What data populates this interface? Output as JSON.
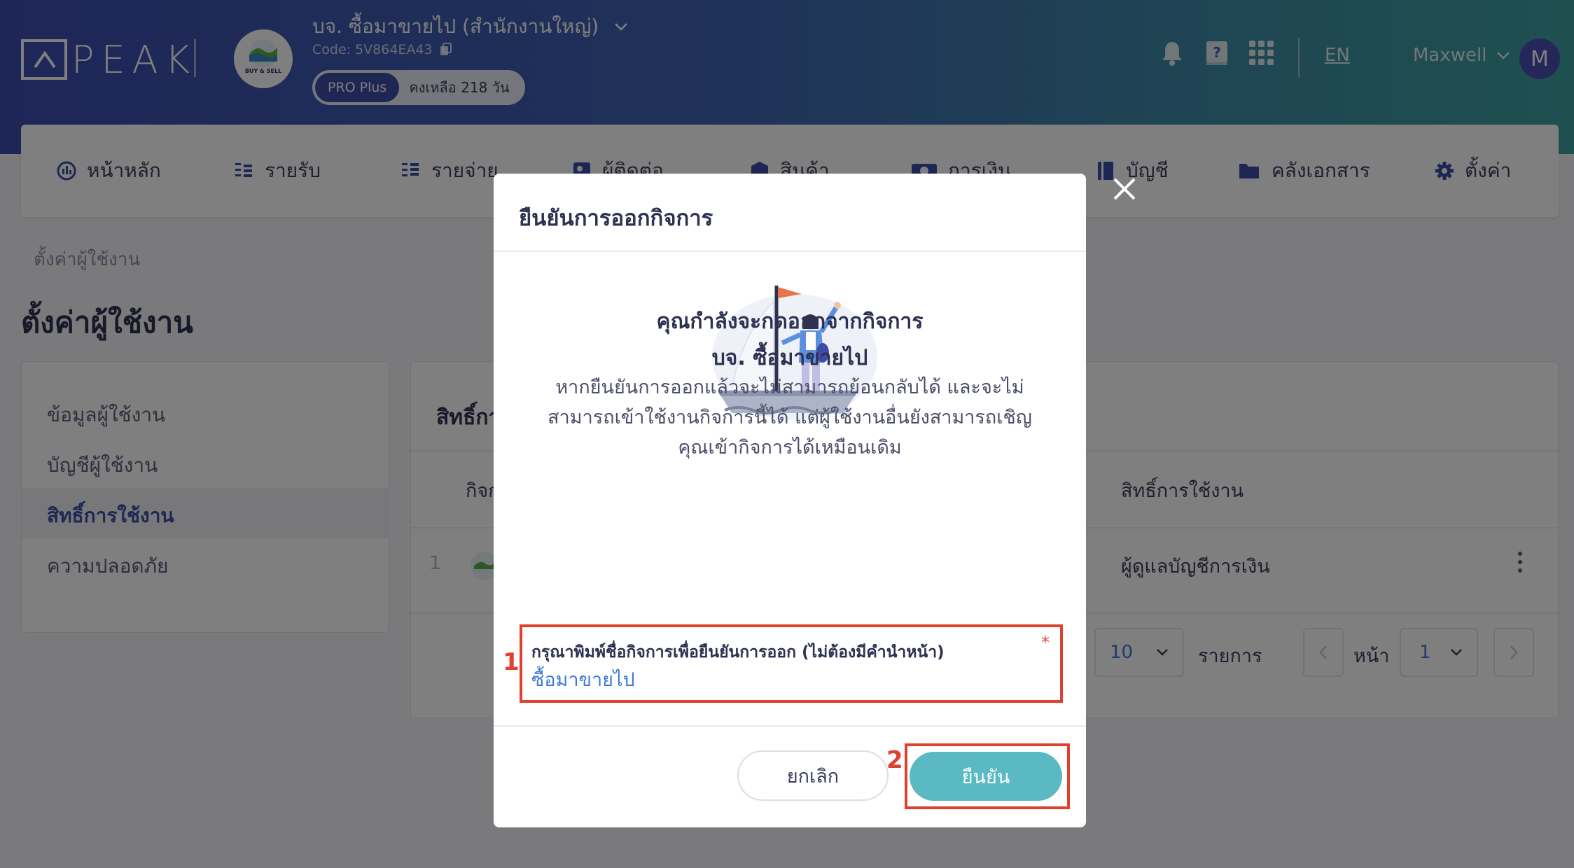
{
  "header": {
    "logo_text": "PEAK",
    "company_name": "บจ. ซื้อมาขายไป (สำนักงานใหญ่)",
    "company_code": "Code: 5V864EA43",
    "company_avatar_text": "BUY & SELL",
    "plan_badge": "PRO Plus",
    "plan_days": "คงเหลือ 218 วัน",
    "language": "EN",
    "user_name": "Maxwell",
    "user_initial": "M"
  },
  "nav": {
    "items": [
      {
        "label": "หน้าหลัก",
        "icon": "dashboard-icon"
      },
      {
        "label": "รายรับ",
        "icon": "income-icon"
      },
      {
        "label": "รายจ่าย",
        "icon": "expense-icon"
      },
      {
        "label": "ผู้ติดต่อ",
        "icon": "contacts-icon"
      },
      {
        "label": "สินค้า",
        "icon": "product-box-icon"
      },
      {
        "label": "การเงิน",
        "icon": "money-icon"
      },
      {
        "label": "บัญชี",
        "icon": "accounting-book-icon"
      },
      {
        "label": "คลังเอกสาร",
        "icon": "folder-icon"
      },
      {
        "label": "ตั้งค่า",
        "icon": "gear-icon"
      }
    ]
  },
  "page": {
    "breadcrumb": "ตั้งค่าผู้ใช้งาน",
    "title": "ตั้งค่าผู้ใช้งาน"
  },
  "sidebar": {
    "items": [
      {
        "label": "ข้อมูลผู้ใช้งาน"
      },
      {
        "label": "บัญชีผู้ใช้งาน"
      },
      {
        "label": "สิทธิ์การใช้งาน"
      },
      {
        "label": "ความปลอดภัย"
      }
    ]
  },
  "card": {
    "title": "สิทธิ์กา",
    "col_business": "กิจก",
    "col_permission": "สิทธิ์การใช้งาน",
    "row_index": "1",
    "row_permission": "ผู้ดูแลบัญชีการเงิน",
    "page_size": "10",
    "items_label": "รายการ",
    "page_label": "หน้า",
    "page_number": "1"
  },
  "modal": {
    "title": "ยืนยันการออกกิจการ",
    "heading_line1": "คุณกำลังจะกดออกจากกิจการ",
    "heading_line2": "บจ. ซื้อมาขายไป",
    "body_line1": "หากยืนยันการออกแล้วจะไม่สามารถย้อนกลับได้ และจะไม่",
    "body_line2": "สามารถเข้าใช้งานกิจการนี้ได้ แต่ผู้ใช้งานอื่นยังสามารถเชิญ",
    "body_line3": "คุณเข้ากิจการได้เหมือนเดิม",
    "field_label": "กรุณาพิมพ์ชื่อกิจการเพื่อยืนยันการออก (ไม่ต้องมีคำนำหน้า)",
    "field_required": "*",
    "field_value": "ซื้อมาขายไป",
    "cancel_label": "ยกเลิก",
    "confirm_label": "ยืนยัน"
  },
  "annotations": {
    "step1": "1",
    "step2": "2"
  },
  "colors": {
    "header_start": "#3d4db0",
    "header_end": "#3fa0a0",
    "confirm_button": "#5ab9c3",
    "annotation": "#e0402e",
    "link": "#3d7bd6"
  }
}
